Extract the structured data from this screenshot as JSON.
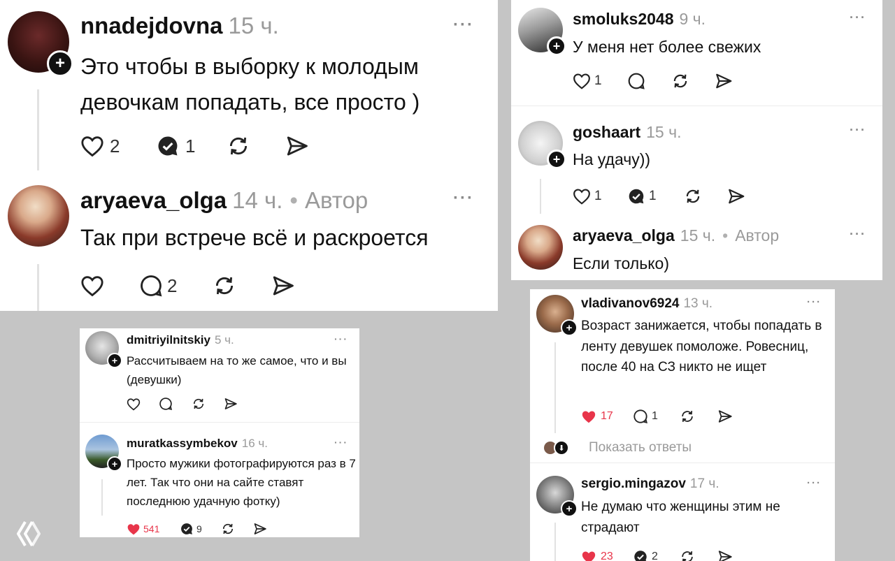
{
  "panels": {
    "top_left": [
      {
        "user": "nnadejdovna",
        "time": "15 ч.",
        "text": "Это чтобы в выборку к молодым девочкам попадать, все просто )",
        "likes": "2",
        "replies": "1",
        "replied": true
      },
      {
        "user": "aryaeva_olga",
        "time": "14 ч.",
        "author": "Автор",
        "text": "Так при встрече всё и раскроется",
        "likes": "",
        "replies": "2",
        "replied": false
      }
    ],
    "top_right": [
      {
        "user": "smoluks2048",
        "time": "9 ч.",
        "text": "У меня нет более свежих",
        "likes": "1",
        "replies": ""
      },
      {
        "user": "goshaart",
        "time": "15 ч.",
        "text": "На удачу))",
        "likes": "1",
        "replies": "1"
      },
      {
        "user": "aryaeva_olga",
        "time": "15 ч.",
        "author": "Автор",
        "text": "Если только)"
      }
    ],
    "bottom_left": [
      {
        "user": "dmitriyilnitskiy",
        "time": "5 ч.",
        "text": "Рассчитываем на то же самое, что и вы (девушки)"
      },
      {
        "user": "muratkassymbekov",
        "time": "16 ч.",
        "text": "Просто мужики фотографируются раз в 7 лет. Так что они на сайте ставят последнюю удачную фотку)",
        "likes": "541",
        "replies": "9"
      }
    ],
    "bottom_right": [
      {
        "user": "vladivanov6924",
        "time": "13 ч.",
        "text": "Возраст занижается, чтобы попадать в ленту девушек помоложе. Ровесниц, после 40 на СЗ никто не ищет",
        "likes": "17",
        "replies": "1"
      },
      {
        "user": "sergio.mingazov",
        "time": "17 ч.",
        "text": "Не думаю что женщины этим не страдают",
        "likes": "23",
        "replies": "2"
      }
    ],
    "show_replies": "Показать ответы"
  },
  "more_glyph": "···",
  "colors": {
    "like_red": "#e8354a",
    "time_gray": "#9a9a9a",
    "background": "#c5c5c5"
  },
  "icons": [
    "heart-icon",
    "comment-icon",
    "repost-icon",
    "share-icon",
    "plus-icon",
    "logo-icon"
  ]
}
